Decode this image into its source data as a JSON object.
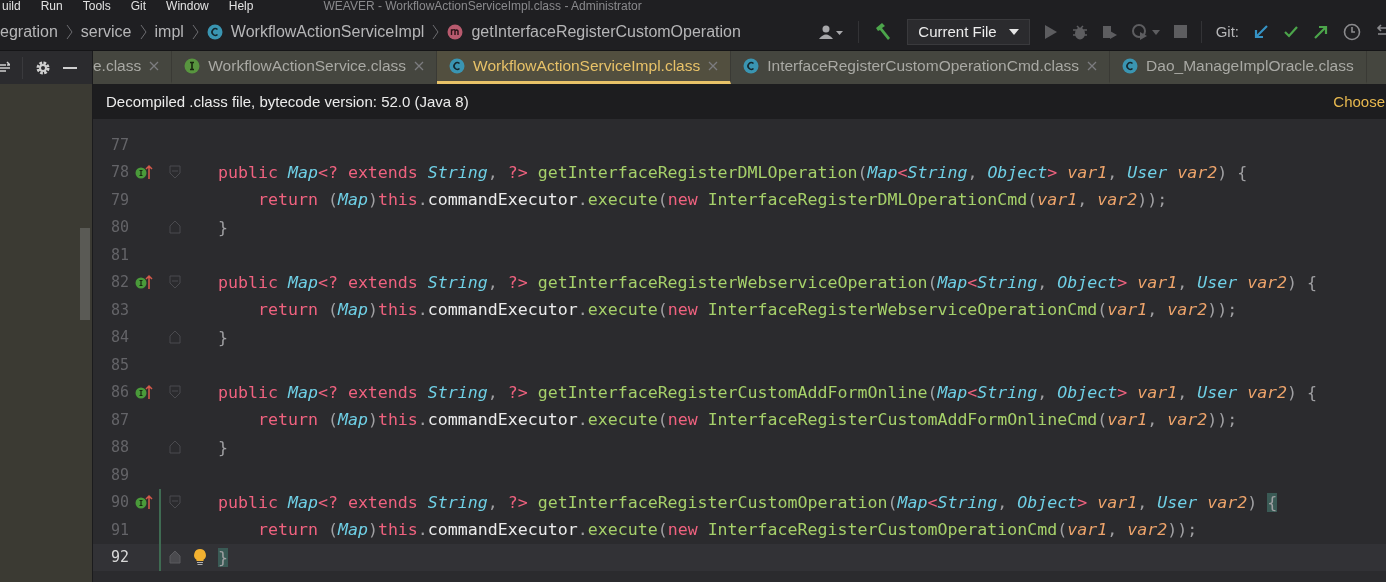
{
  "menu": {
    "items": [
      "uild",
      "Run",
      "Tools",
      "Git",
      "Window",
      "Help"
    ],
    "title": "WEAVER - WorkflowActionServiceImpl.class - Administrator"
  },
  "breadcrumbs": [
    {
      "label": "egration",
      "kind": "package"
    },
    {
      "label": "service",
      "kind": "package"
    },
    {
      "label": "impl",
      "kind": "package"
    },
    {
      "label": "WorkflowActionServiceImpl",
      "kind": "class"
    },
    {
      "label": "getInterfaceRegisterCustomOperation",
      "kind": "method"
    }
  ],
  "toolbar": {
    "run_config": "Current File",
    "git_label": "Git:"
  },
  "tabs": [
    {
      "label": "e.class",
      "kind": "plain",
      "selected": false,
      "closable": true
    },
    {
      "label": "WorkflowActionService.class",
      "kind": "interface",
      "selected": false,
      "closable": true
    },
    {
      "label": "WorkflowActionServiceImpl.class",
      "kind": "class",
      "selected": true,
      "closable": true
    },
    {
      "label": "InterfaceRegisterCustomOperationCmd.class",
      "kind": "class",
      "selected": false,
      "closable": true
    },
    {
      "label": "Dao_ManageImplOracle.class",
      "kind": "class",
      "selected": false,
      "closable": false
    }
  ],
  "banner": {
    "message": "Decompiled .class file, bytecode version: 52.0 (Java 8)",
    "action": "Choose"
  },
  "lines": [
    {
      "number": "77",
      "current": false,
      "changed": false,
      "implements": false,
      "fold_start": false,
      "fold_end": false,
      "bulb": false
    },
    {
      "number": "78",
      "current": false,
      "changed": false,
      "implements": true,
      "fold_start": true,
      "fold_end": false,
      "bulb": false,
      "tokens": [
        {
          "kind": "kw",
          "text": "public "
        },
        {
          "kind": "type",
          "text": "Map"
        },
        {
          "kind": "kw",
          "text": "<? extends "
        },
        {
          "kind": "type",
          "text": "String"
        },
        {
          "kind": "punct",
          "text": ", "
        },
        {
          "kind": "kw",
          "text": "?> "
        },
        {
          "kind": "method",
          "text": "getInterfaceRegisterDMLOperation"
        },
        {
          "kind": "punct",
          "text": "("
        },
        {
          "kind": "type",
          "text": "Map"
        },
        {
          "kind": "kw",
          "text": "<"
        },
        {
          "kind": "type",
          "text": "String"
        },
        {
          "kind": "punct",
          "text": ", "
        },
        {
          "kind": "type",
          "text": "Object"
        },
        {
          "kind": "kw",
          "text": "> "
        },
        {
          "kind": "param",
          "text": "var1"
        },
        {
          "kind": "punct",
          "text": ", "
        },
        {
          "kind": "type",
          "text": "User "
        },
        {
          "kind": "param",
          "text": "var2"
        },
        {
          "kind": "punct",
          "text": ") {"
        }
      ]
    },
    {
      "number": "79",
      "current": false,
      "changed": false,
      "implements": false,
      "fold_start": false,
      "fold_end": false,
      "bulb": false,
      "tokens": [
        {
          "kind": "kw",
          "text": "    return "
        },
        {
          "kind": "punct",
          "text": "("
        },
        {
          "kind": "type",
          "text": "Map"
        },
        {
          "kind": "punct",
          "text": ")"
        },
        {
          "kind": "kw",
          "text": "this"
        },
        {
          "kind": "punct",
          "text": "."
        },
        {
          "kind": "ident",
          "text": "commandExecutor"
        },
        {
          "kind": "punct",
          "text": "."
        },
        {
          "kind": "method",
          "text": "execute"
        },
        {
          "kind": "punct",
          "text": "("
        },
        {
          "kind": "kw",
          "text": "new "
        },
        {
          "kind": "method",
          "text": "InterfaceRegisterDMLOperationCmd"
        },
        {
          "kind": "punct",
          "text": "("
        },
        {
          "kind": "param",
          "text": "var1"
        },
        {
          "kind": "punct",
          "text": ", "
        },
        {
          "kind": "param",
          "text": "var2"
        },
        {
          "kind": "punct",
          "text": "));"
        }
      ]
    },
    {
      "number": "80",
      "current": false,
      "changed": false,
      "implements": false,
      "fold_start": false,
      "fold_end": true,
      "bulb": false,
      "tokens": [
        {
          "kind": "punct",
          "text": "}"
        }
      ]
    },
    {
      "number": "81",
      "current": false,
      "changed": false,
      "implements": false,
      "fold_start": false,
      "fold_end": false,
      "bulb": false
    },
    {
      "number": "82",
      "current": false,
      "changed": false,
      "implements": true,
      "fold_start": true,
      "fold_end": false,
      "bulb": false,
      "tokens": [
        {
          "kind": "kw",
          "text": "public "
        },
        {
          "kind": "type",
          "text": "Map"
        },
        {
          "kind": "kw",
          "text": "<? extends "
        },
        {
          "kind": "type",
          "text": "String"
        },
        {
          "kind": "punct",
          "text": ", "
        },
        {
          "kind": "kw",
          "text": "?> "
        },
        {
          "kind": "method",
          "text": "getInterfaceRegisterWebserviceOperation"
        },
        {
          "kind": "punct",
          "text": "("
        },
        {
          "kind": "type",
          "text": "Map"
        },
        {
          "kind": "kw",
          "text": "<"
        },
        {
          "kind": "type",
          "text": "String"
        },
        {
          "kind": "punct",
          "text": ", "
        },
        {
          "kind": "type",
          "text": "Object"
        },
        {
          "kind": "kw",
          "text": "> "
        },
        {
          "kind": "param",
          "text": "var1"
        },
        {
          "kind": "punct",
          "text": ", "
        },
        {
          "kind": "type",
          "text": "User "
        },
        {
          "kind": "param",
          "text": "var2"
        },
        {
          "kind": "punct",
          "text": ") {"
        }
      ]
    },
    {
      "number": "83",
      "current": false,
      "changed": false,
      "implements": false,
      "fold_start": false,
      "fold_end": false,
      "bulb": false,
      "tokens": [
        {
          "kind": "kw",
          "text": "    return "
        },
        {
          "kind": "punct",
          "text": "("
        },
        {
          "kind": "type",
          "text": "Map"
        },
        {
          "kind": "punct",
          "text": ")"
        },
        {
          "kind": "kw",
          "text": "this"
        },
        {
          "kind": "punct",
          "text": "."
        },
        {
          "kind": "ident",
          "text": "commandExecutor"
        },
        {
          "kind": "punct",
          "text": "."
        },
        {
          "kind": "method",
          "text": "execute"
        },
        {
          "kind": "punct",
          "text": "("
        },
        {
          "kind": "kw",
          "text": "new "
        },
        {
          "kind": "method",
          "text": "InterfaceRegisterWebserviceOperationCmd"
        },
        {
          "kind": "punct",
          "text": "("
        },
        {
          "kind": "param",
          "text": "var1"
        },
        {
          "kind": "punct",
          "text": ", "
        },
        {
          "kind": "param",
          "text": "var2"
        },
        {
          "kind": "punct",
          "text": "));"
        }
      ]
    },
    {
      "number": "84",
      "current": false,
      "changed": false,
      "implements": false,
      "fold_start": false,
      "fold_end": true,
      "bulb": false,
      "tokens": [
        {
          "kind": "punct",
          "text": "}"
        }
      ]
    },
    {
      "number": "85",
      "current": false,
      "changed": false,
      "implements": false,
      "fold_start": false,
      "fold_end": false,
      "bulb": false
    },
    {
      "number": "86",
      "current": false,
      "changed": false,
      "implements": true,
      "fold_start": true,
      "fold_end": false,
      "bulb": false,
      "tokens": [
        {
          "kind": "kw",
          "text": "public "
        },
        {
          "kind": "type",
          "text": "Map"
        },
        {
          "kind": "kw",
          "text": "<? extends "
        },
        {
          "kind": "type",
          "text": "String"
        },
        {
          "kind": "punct",
          "text": ", "
        },
        {
          "kind": "kw",
          "text": "?> "
        },
        {
          "kind": "method",
          "text": "getInterfaceRegisterCustomAddFormOnline"
        },
        {
          "kind": "punct",
          "text": "("
        },
        {
          "kind": "type",
          "text": "Map"
        },
        {
          "kind": "kw",
          "text": "<"
        },
        {
          "kind": "type",
          "text": "String"
        },
        {
          "kind": "punct",
          "text": ", "
        },
        {
          "kind": "type",
          "text": "Object"
        },
        {
          "kind": "kw",
          "text": "> "
        },
        {
          "kind": "param",
          "text": "var1"
        },
        {
          "kind": "punct",
          "text": ", "
        },
        {
          "kind": "type",
          "text": "User "
        },
        {
          "kind": "param",
          "text": "var2"
        },
        {
          "kind": "punct",
          "text": ") {"
        }
      ]
    },
    {
      "number": "87",
      "current": false,
      "changed": false,
      "implements": false,
      "fold_start": false,
      "fold_end": false,
      "bulb": false,
      "tokens": [
        {
          "kind": "kw",
          "text": "    return "
        },
        {
          "kind": "punct",
          "text": "("
        },
        {
          "kind": "type",
          "text": "Map"
        },
        {
          "kind": "punct",
          "text": ")"
        },
        {
          "kind": "kw",
          "text": "this"
        },
        {
          "kind": "punct",
          "text": "."
        },
        {
          "kind": "ident",
          "text": "commandExecutor"
        },
        {
          "kind": "punct",
          "text": "."
        },
        {
          "kind": "method",
          "text": "execute"
        },
        {
          "kind": "punct",
          "text": "("
        },
        {
          "kind": "kw",
          "text": "new "
        },
        {
          "kind": "method",
          "text": "InterfaceRegisterCustomAddFormOnlineCmd"
        },
        {
          "kind": "punct",
          "text": "("
        },
        {
          "kind": "param",
          "text": "var1"
        },
        {
          "kind": "punct",
          "text": ", "
        },
        {
          "kind": "param",
          "text": "var2"
        },
        {
          "kind": "punct",
          "text": "));"
        }
      ]
    },
    {
      "number": "88",
      "current": false,
      "changed": false,
      "implements": false,
      "fold_start": false,
      "fold_end": true,
      "bulb": false,
      "tokens": [
        {
          "kind": "punct",
          "text": "}"
        }
      ]
    },
    {
      "number": "89",
      "current": false,
      "changed": false,
      "implements": false,
      "fold_start": false,
      "fold_end": false,
      "bulb": false
    },
    {
      "number": "90",
      "current": false,
      "changed": true,
      "implements": true,
      "fold_start": true,
      "fold_end": false,
      "bulb": false,
      "tokens": [
        {
          "kind": "kw",
          "text": "public "
        },
        {
          "kind": "type",
          "text": "Map"
        },
        {
          "kind": "kw",
          "text": "<? extends "
        },
        {
          "kind": "type",
          "text": "String"
        },
        {
          "kind": "punct",
          "text": ", "
        },
        {
          "kind": "kw",
          "text": "?> "
        },
        {
          "kind": "method",
          "text": "getInterfaceRegisterCustomOperation"
        },
        {
          "kind": "punct",
          "text": "("
        },
        {
          "kind": "type",
          "text": "Map"
        },
        {
          "kind": "kw",
          "text": "<"
        },
        {
          "kind": "type",
          "text": "String"
        },
        {
          "kind": "punct",
          "text": ", "
        },
        {
          "kind": "type",
          "text": "Object"
        },
        {
          "kind": "kw",
          "text": "> "
        },
        {
          "kind": "param",
          "text": "var1"
        },
        {
          "kind": "punct",
          "text": ", "
        },
        {
          "kind": "type",
          "text": "User "
        },
        {
          "kind": "param",
          "text": "var2"
        },
        {
          "kind": "punct",
          "text": ") "
        },
        {
          "kind": "match",
          "text": "{"
        }
      ]
    },
    {
      "number": "91",
      "current": false,
      "changed": true,
      "implements": false,
      "fold_start": false,
      "fold_end": false,
      "bulb": false,
      "tokens": [
        {
          "kind": "kw",
          "text": "    return "
        },
        {
          "kind": "punct",
          "text": "("
        },
        {
          "kind": "type",
          "text": "Map"
        },
        {
          "kind": "punct",
          "text": ")"
        },
        {
          "kind": "kw",
          "text": "this"
        },
        {
          "kind": "punct",
          "text": "."
        },
        {
          "kind": "ident",
          "text": "commandExecutor"
        },
        {
          "kind": "punct",
          "text": "."
        },
        {
          "kind": "method",
          "text": "execute"
        },
        {
          "kind": "punct",
          "text": "("
        },
        {
          "kind": "kw",
          "text": "new "
        },
        {
          "kind": "method",
          "text": "InterfaceRegisterCustomOperationCmd"
        },
        {
          "kind": "punct",
          "text": "("
        },
        {
          "kind": "param",
          "text": "var1"
        },
        {
          "kind": "punct",
          "text": ", "
        },
        {
          "kind": "param",
          "text": "var2"
        },
        {
          "kind": "punct",
          "text": "));"
        }
      ]
    },
    {
      "number": "92",
      "current": true,
      "changed": true,
      "implements": false,
      "fold_start": false,
      "fold_end": true,
      "bulb": true,
      "tokens": [
        {
          "kind": "match",
          "text": "}"
        }
      ]
    }
  ]
}
